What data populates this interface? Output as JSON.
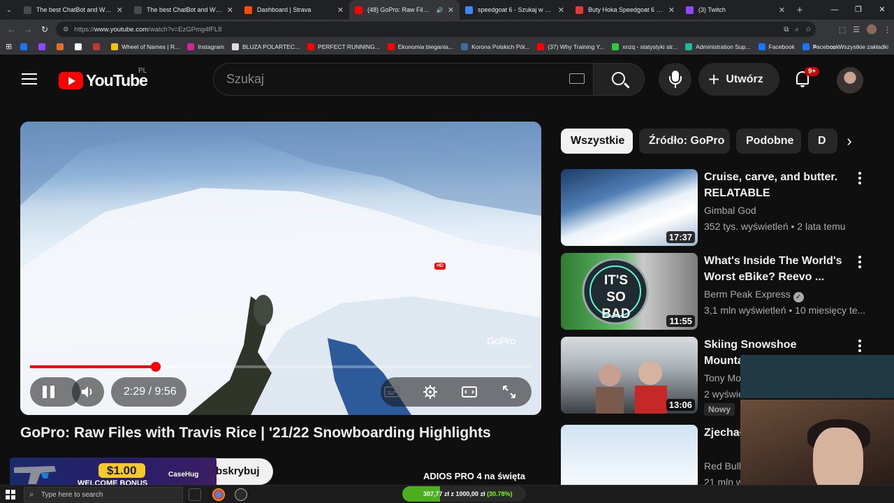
{
  "browser": {
    "tabs": [
      {
        "label": "The best ChatBot and Widgets",
        "favicon_color": "#4a4a4a"
      },
      {
        "label": "The best ChatBot and Widgets",
        "favicon_color": "#4a4a4a"
      },
      {
        "label": "Dashboard | Strava",
        "favicon_color": "#fc4c02"
      },
      {
        "label": "(48) GoPro: Raw Files with T",
        "favicon_color": "#ff0000",
        "active": true
      },
      {
        "label": "speedgoat 6 - Szukaj w Google",
        "favicon_color": "#4285f4"
      },
      {
        "label": "Buty Hoka Speedgoat 6 M Ziel",
        "favicon_color": "#e53935"
      },
      {
        "label": "(3) Twitch",
        "favicon_color": "#9146ff"
      }
    ],
    "url_prefix": "https://",
    "url_host": "www.youtube.com",
    "url_path": "/watch?v=EzGPmg4fFL8",
    "bookmarks": [
      {
        "label": "",
        "color": "#1877f2"
      },
      {
        "label": "",
        "color": "#9146ff"
      },
      {
        "label": "",
        "color": "#e56c25"
      },
      {
        "label": "",
        "color": "#ffffff"
      },
      {
        "label": "",
        "color": "#c0392b"
      },
      {
        "label": "Wheel of Names | R...",
        "color": "#f1c40f"
      },
      {
        "label": "Instagram",
        "color": "#d6249f"
      },
      {
        "label": "BLUZA POLARTEC...",
        "color": "#dddddd"
      },
      {
        "label": "PERFECT RUNNING...",
        "color": "#ff0000"
      },
      {
        "label": "Ekonomia biegania...",
        "color": "#ff0000"
      },
      {
        "label": "Korona Polskich Pół...",
        "color": "#3a6ea5"
      },
      {
        "label": "(37) Why Training Y...",
        "color": "#ff0000"
      },
      {
        "label": "xnzq - statystyki str...",
        "color": "#2ecc40"
      },
      {
        "label": "Administration Sup...",
        "color": "#1abc9c"
      },
      {
        "label": "Facebook",
        "color": "#1877f2"
      },
      {
        "label": "Facebook",
        "color": "#1877f2"
      }
    ],
    "bookmarks_more": "»",
    "all_bookmarks": "Wszystkie zakładki"
  },
  "youtube": {
    "logo_text": "YouTube",
    "region": "PL",
    "search_placeholder": "Szukaj",
    "create_label": "Utwórz",
    "notification_badge": "9+"
  },
  "player": {
    "current_time": "2:29",
    "duration": "9:56",
    "time_display": "2:29 / 9:56",
    "progress_fraction": 0.25,
    "buffer_fraction": 0.29,
    "watermark": "GoPro",
    "hd_label": "HD"
  },
  "video": {
    "title": "GoPro: Raw Files with Travis Rice | '21/22 Snowboarding Highlights",
    "subscribe_label": "bskrybuj",
    "side_text": "ADIOS PRO 4 na święta"
  },
  "ad": {
    "amount": "$1.00",
    "bonus": "WELCOME BONUS",
    "brand": "CaseHug"
  },
  "chips": [
    {
      "label": "Wszystkie",
      "active": true
    },
    {
      "label": "Źródło: GoPro",
      "active": false
    },
    {
      "label": "Podobne",
      "active": false
    },
    {
      "label": "D",
      "active": false
    }
  ],
  "recommendations": [
    {
      "title": "Cruise, carve, and butter. RELATABLE snowboarding.",
      "channel": "Gimbal God",
      "meta": "352 tys. wyświetleń • 2 lata temu",
      "duration": "17:37",
      "verified": false
    },
    {
      "title": "What's Inside The World's Worst eBike? Reevo ...",
      "channel": "Berm Peak Express",
      "meta": "3,1 mln wyświetleń • 10 miesięcy te...",
      "duration": "11:55",
      "verified": true,
      "thumb_text": "IT'S SO BAD"
    },
    {
      "title": "Skiing Snowshoe Mountain Openin",
      "channel": "Tony Mo",
      "meta": "2 wyświe",
      "duration": "13:06",
      "verified": false,
      "badge": "Nowy"
    },
    {
      "title": "Zjechał Mount",
      "channel": "Red Bull",
      "meta": "21 mln w",
      "duration": "",
      "verified": false
    }
  ],
  "taskbar": {
    "search_placeholder": "Type here to search",
    "donation_text": "307,77 zł z 1000,00 zł",
    "donation_pct": "(30.78%)",
    "donation_fraction": 0.3078
  }
}
